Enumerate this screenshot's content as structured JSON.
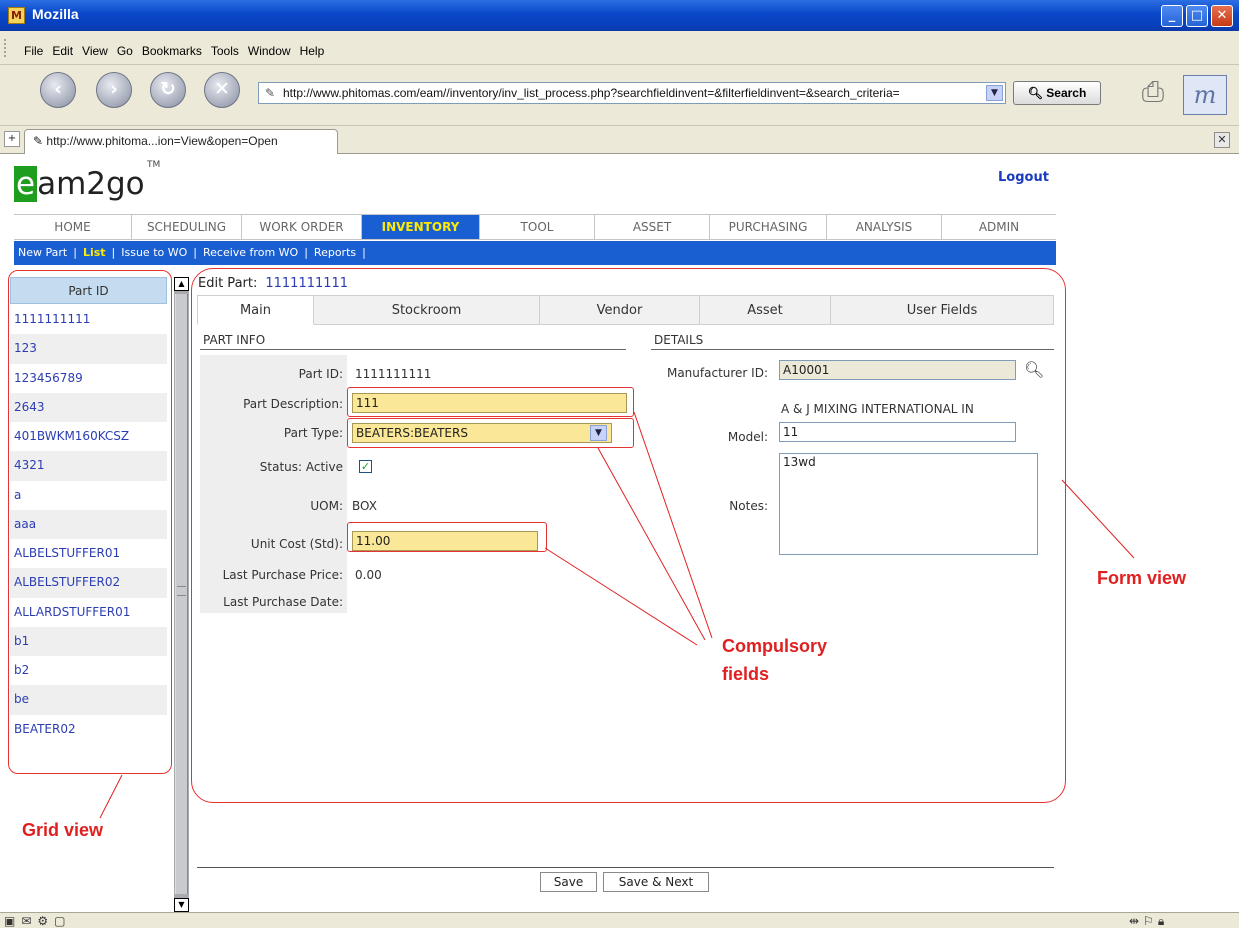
{
  "window": {
    "title": "Mozilla",
    "min": "_",
    "max": "□",
    "close": "✕"
  },
  "menu": [
    "File",
    "Edit",
    "View",
    "Go",
    "Bookmarks",
    "Tools",
    "Window",
    "Help"
  ],
  "nav": {
    "url": "http://www.phitomas.com/eam//inventory/inv_list_process.php?searchfieldinvent=&filterfieldinvent=&search_criteria=",
    "search_label": "Search",
    "back": "‹",
    "forward": "›",
    "reload": "↻",
    "stop": "✕",
    "throbber": "m"
  },
  "tabbar": {
    "tab_title": "http://www.phitoma...ion=View&open=Open"
  },
  "app": {
    "logo_e": "e",
    "logo_rest": "am2go",
    "tm": "TM",
    "logout": "Logout",
    "main_nav": [
      "HOME",
      "SCHEDULING",
      "WORK ORDER",
      "INVENTORY",
      "TOOL",
      "ASSET",
      "PURCHASING",
      "ANALYSIS",
      "ADMIN"
    ],
    "active_nav": "INVENTORY",
    "sub_nav": [
      "New Part",
      "List",
      "Issue to WO",
      "Receive from WO",
      "Reports"
    ]
  },
  "grid": {
    "header": "Part ID",
    "rows": [
      "1111111111",
      "123",
      "123456789",
      "2643",
      "401BWKM160KCSZ",
      "4321",
      "a",
      "aaa",
      "ALBELSTUFFER01",
      "ALBELSTUFFER02",
      "ALLARDSTUFFER01",
      "b1",
      "b2",
      "be",
      "BEATER02"
    ]
  },
  "form": {
    "title_label": "Edit Part:",
    "title_value": "1111111111",
    "tabs": [
      "Main",
      "Stockroom",
      "Vendor",
      "Asset",
      "User Fields"
    ],
    "part_info_title": "PART INFO",
    "details_title": "DETAILS",
    "labels": {
      "part_id": "Part ID:",
      "part_description": "Part Description:",
      "part_type": "Part Type:",
      "status": "Status: Active",
      "uom": "UOM:",
      "unit_cost": "Unit Cost (Std):",
      "last_purchase_price": "Last Purchase Price:",
      "last_purchase_date": "Last Purchase Date:",
      "manufacturer_id": "Manufacturer ID:",
      "model": "Model:",
      "notes": "Notes:"
    },
    "values": {
      "part_id": "1111111111",
      "part_description": "111",
      "part_type": "BEATERS:BEATERS",
      "uom": "BOX",
      "unit_cost": "11.00",
      "last_purchase_price": "0.00",
      "last_purchase_date": "",
      "manufacturer_id": "A10001",
      "manufacturer_name": "A & J MIXING INTERNATIONAL  IN",
      "model": "11",
      "notes": "13wd"
    },
    "status_checked": true,
    "save": "Save",
    "save_next": "Save & Next"
  },
  "annotations": {
    "form_view": "Form view",
    "compulsory_line1": "Compulsory",
    "compulsory_line2": "fields",
    "grid_view": "Grid view"
  },
  "colors": {
    "accent": "#1a5fd1",
    "active_nav_text": "#ffea00",
    "required_bg": "#fae797",
    "annotation": "#e02020"
  }
}
